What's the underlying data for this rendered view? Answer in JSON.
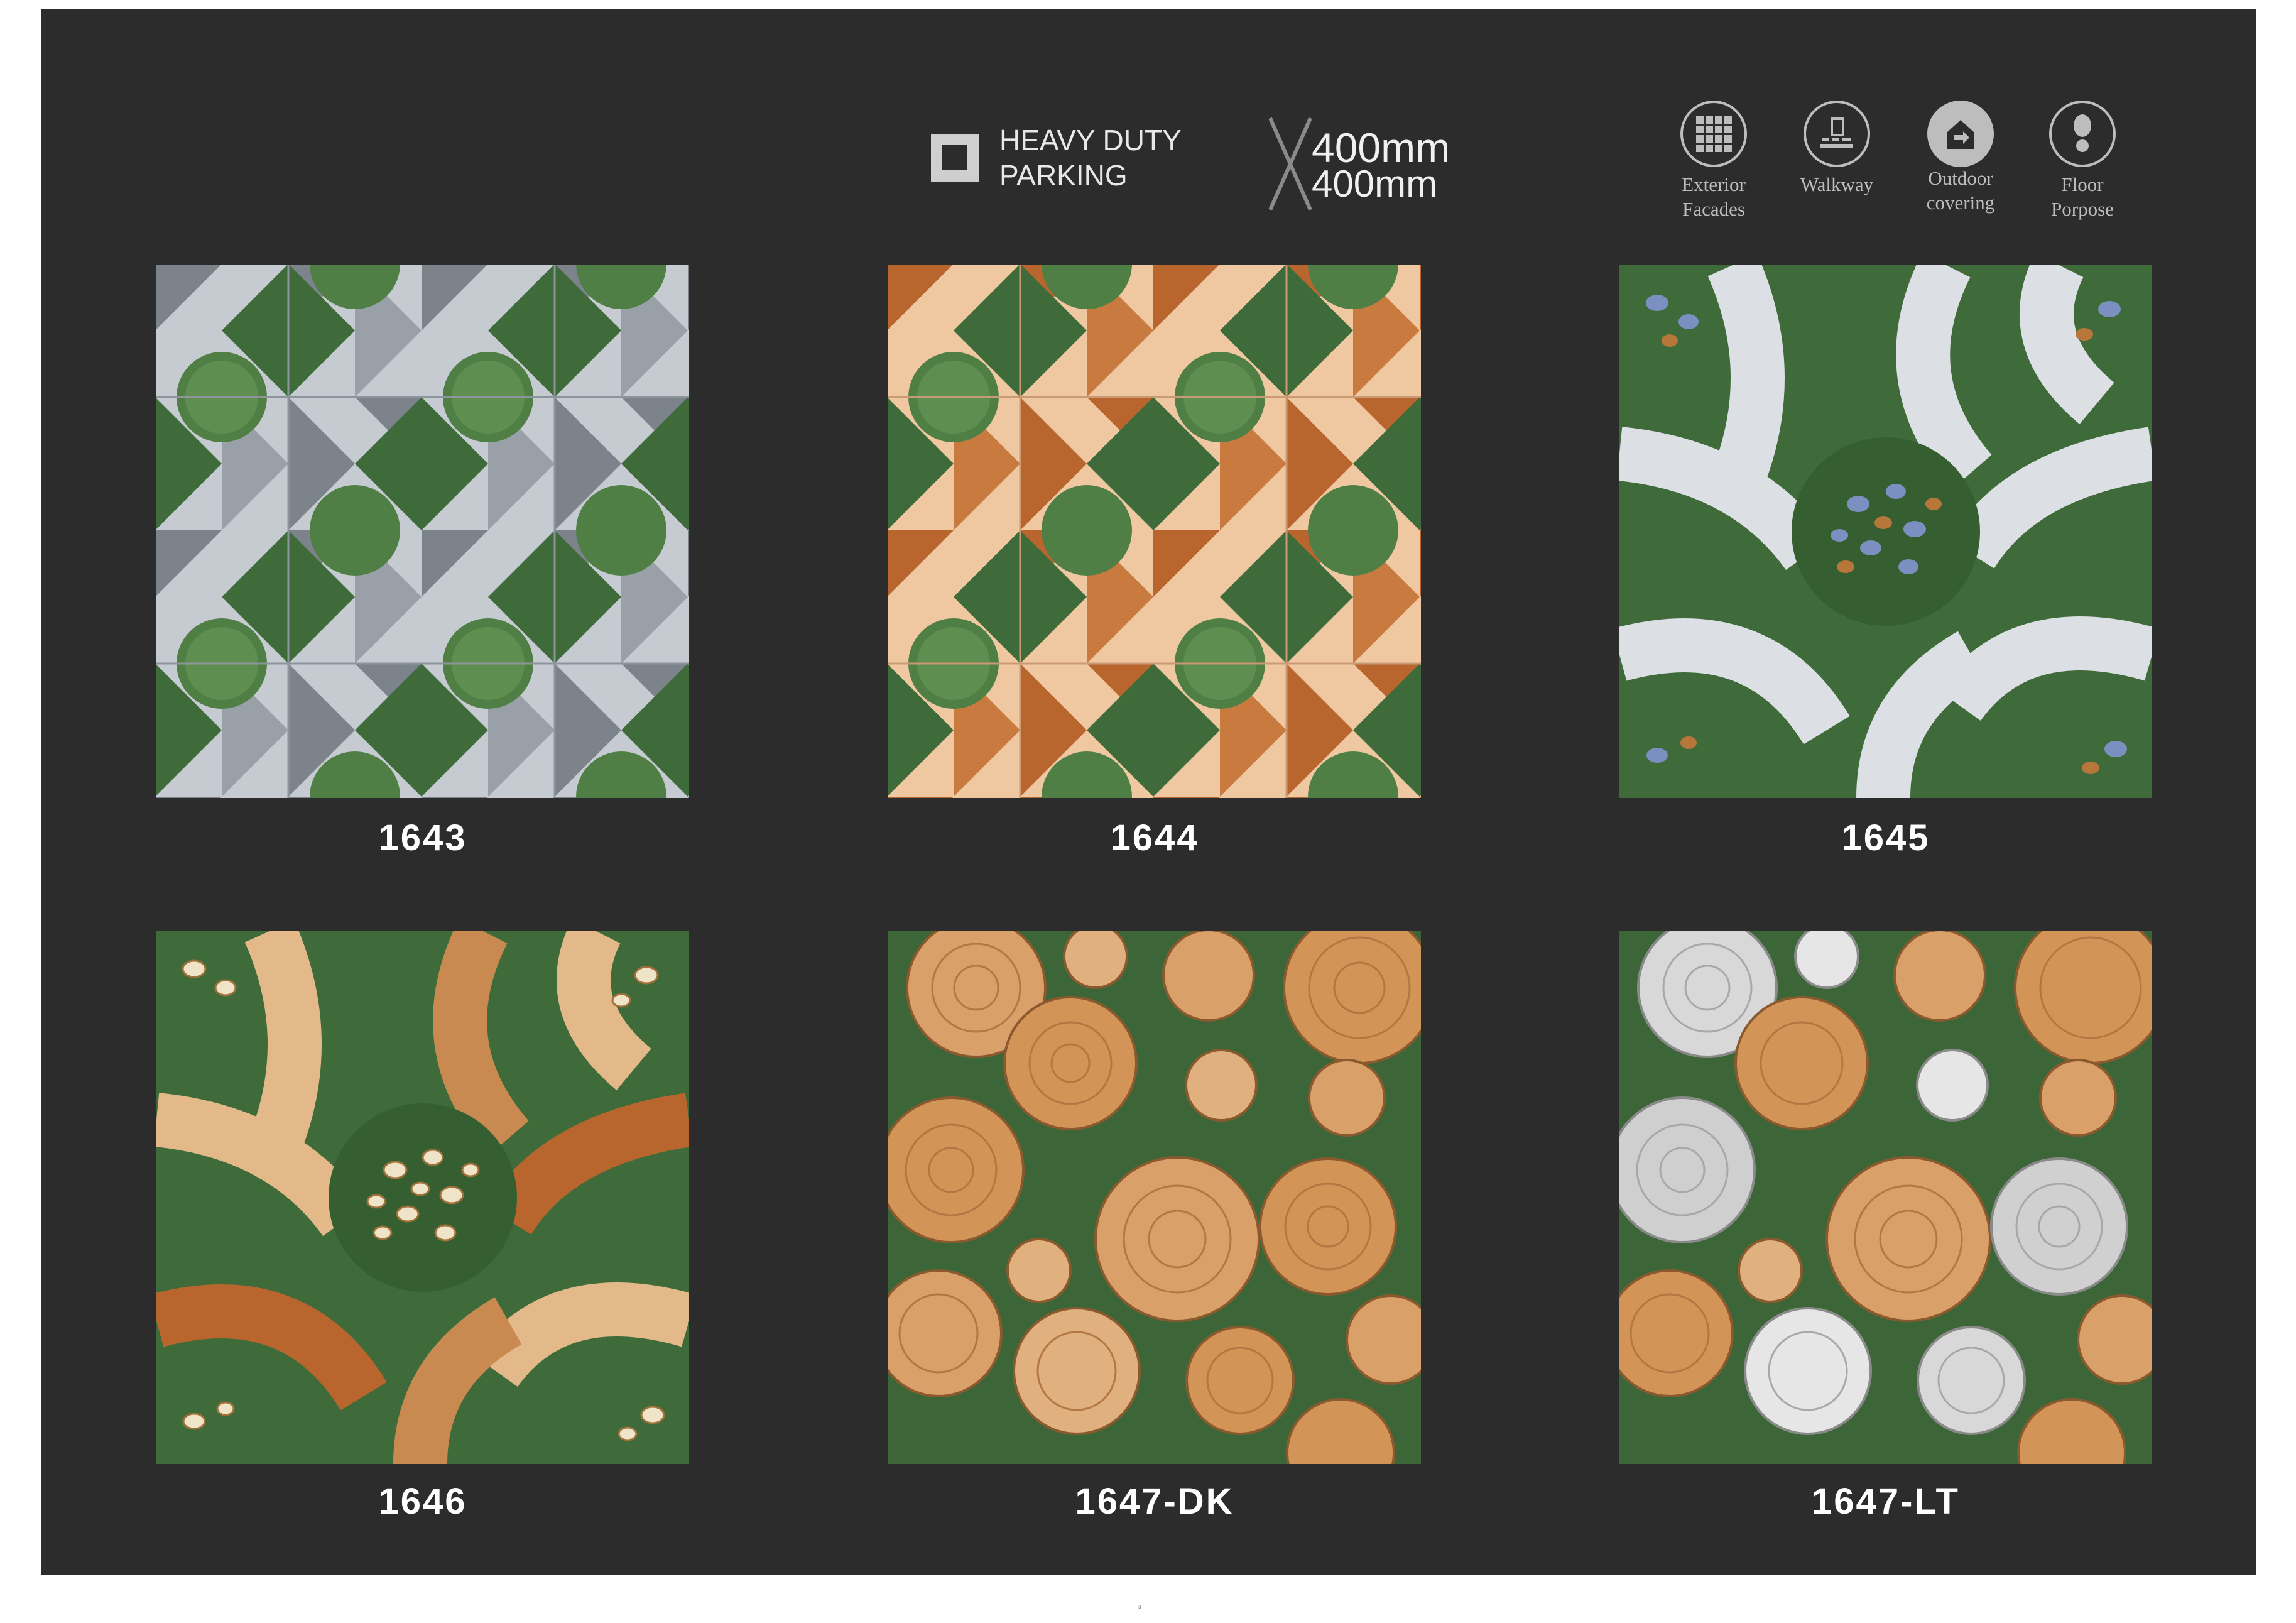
{
  "badge": {
    "line1": "HEAVY DUTY",
    "line2": "PARKING"
  },
  "size": {
    "line1": "400mm",
    "line2": "400mm"
  },
  "features": [
    {
      "icon": "grid-facade-icon",
      "label1": "Exterior",
      "label2": "Facades"
    },
    {
      "icon": "walkway-icon",
      "label1": "Walkway",
      "label2": ""
    },
    {
      "icon": "outdoor-house-icon",
      "label1": "Outdoor",
      "label2": "covering"
    },
    {
      "icon": "footprint-icon",
      "label1": "Floor",
      "label2": "Porpose"
    }
  ],
  "tiles": [
    {
      "code": "1643",
      "pattern": "diamond-grass-grey"
    },
    {
      "code": "1644",
      "pattern": "diamond-grass-terracotta"
    },
    {
      "code": "1645",
      "pattern": "arcs-pebbles-white"
    },
    {
      "code": "1646",
      "pattern": "arcs-pebbles-wood"
    },
    {
      "code": "1647-DK",
      "pattern": "wood-slices-dark"
    },
    {
      "code": "1647-LT",
      "pattern": "wood-slices-light"
    }
  ],
  "colors": {
    "panel": "#2c2c2c",
    "grass": "#3f6b3a",
    "grey_light": "#c6cbd2",
    "grey_dark": "#7d838b",
    "terracotta": "#b8662e",
    "sand": "#efc8a2",
    "wood": "#c98a52",
    "wood_light": "#e4b98a",
    "silver": "#d8d8d8"
  },
  "page_number": "3"
}
